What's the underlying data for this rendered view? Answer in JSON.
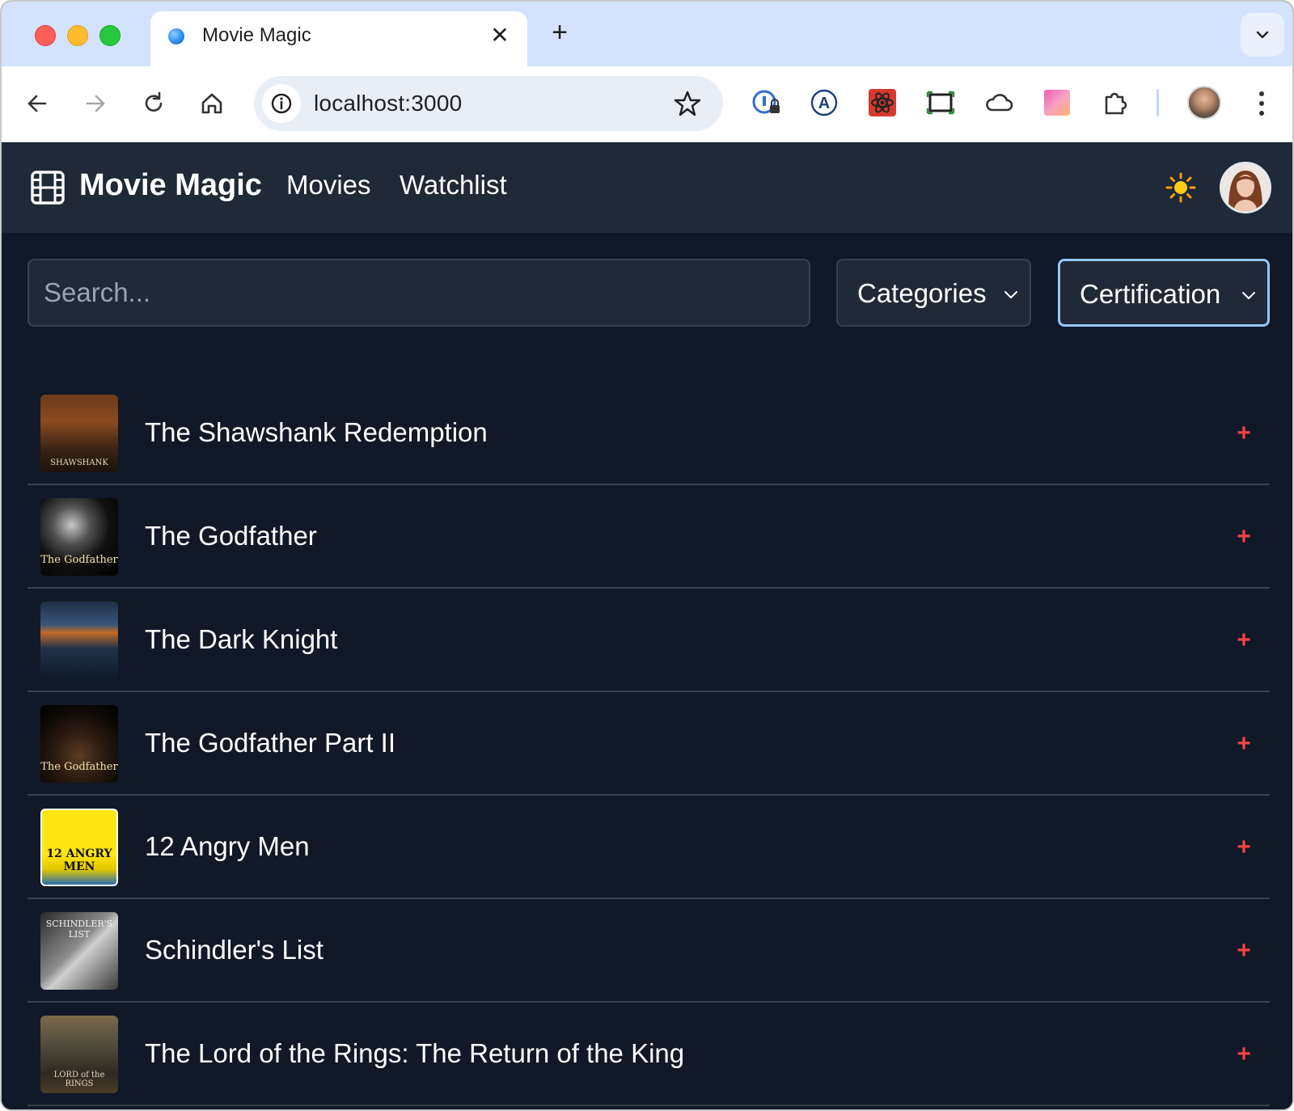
{
  "browser": {
    "tab_title": "Movie Magic",
    "url": "localhost:3000"
  },
  "header": {
    "brand": "Movie Magic",
    "nav": [
      "Movies",
      "Watchlist"
    ]
  },
  "filters": {
    "search_placeholder": "Search...",
    "categories_label": "Categories",
    "certification_label": "Certification"
  },
  "movies": [
    {
      "title": "The Shawshank Redemption",
      "poster_text": "SHAWSHANK",
      "action": "+"
    },
    {
      "title": "The Godfather",
      "poster_text": "The Godfather",
      "action": "+"
    },
    {
      "title": "The Dark Knight",
      "poster_text": "",
      "action": "+"
    },
    {
      "title": "The Godfather Part II",
      "poster_text": "The Godfather",
      "action": "+"
    },
    {
      "title": "12 Angry Men",
      "poster_text": "12 ANGRY MEN",
      "action": "+"
    },
    {
      "title": "Schindler's List",
      "poster_text": "SCHINDLER'S LIST",
      "action": "+"
    },
    {
      "title": "The Lord of the Rings: The Return of the King",
      "poster_text": "LORD of the RINGS",
      "action": "+"
    }
  ],
  "colors": {
    "app_bg": "#111827",
    "header_bg": "#1f2937",
    "border": "#374151",
    "accent_focus": "#93c5fd",
    "add_red": "#ef4444",
    "tabstrip_bg": "#d3e3fd"
  }
}
